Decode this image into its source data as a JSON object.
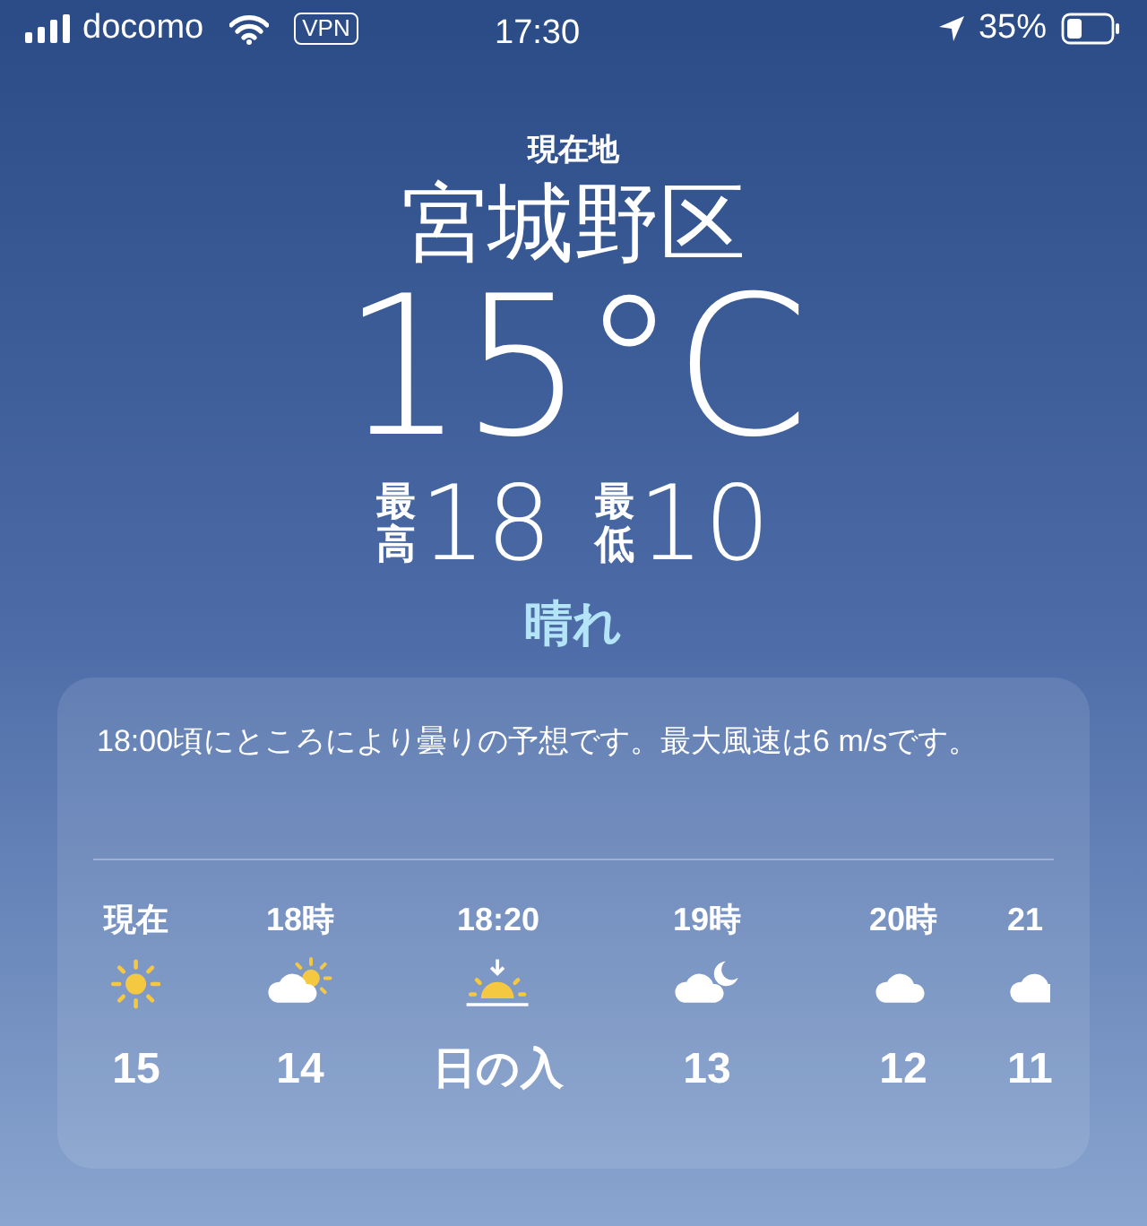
{
  "status_bar": {
    "carrier": "docomo",
    "vpn": "VPN",
    "time": "17:30",
    "battery": "35%"
  },
  "location": {
    "label": "現在地",
    "name": "宮城野区",
    "temperature": "15°C",
    "high_label": "最高",
    "high": "18",
    "low_label": "最低",
    "low": "10",
    "condition": "晴れ"
  },
  "hourly": {
    "summary": "18:00頃にところにより曇りの予想です。最大風速は6 m/sです。",
    "items": [
      {
        "time": "現在",
        "kind": "sun",
        "value": "15"
      },
      {
        "time": "18時",
        "kind": "partly_cloudy",
        "value": "14"
      },
      {
        "time": "18:20",
        "kind": "sunset",
        "value": "日の入"
      },
      {
        "time": "19時",
        "kind": "cloudy_night",
        "value": "13"
      },
      {
        "time": "20時",
        "kind": "cloud",
        "value": "12"
      },
      {
        "time": "21",
        "kind": "cloud",
        "value": "11"
      }
    ]
  }
}
